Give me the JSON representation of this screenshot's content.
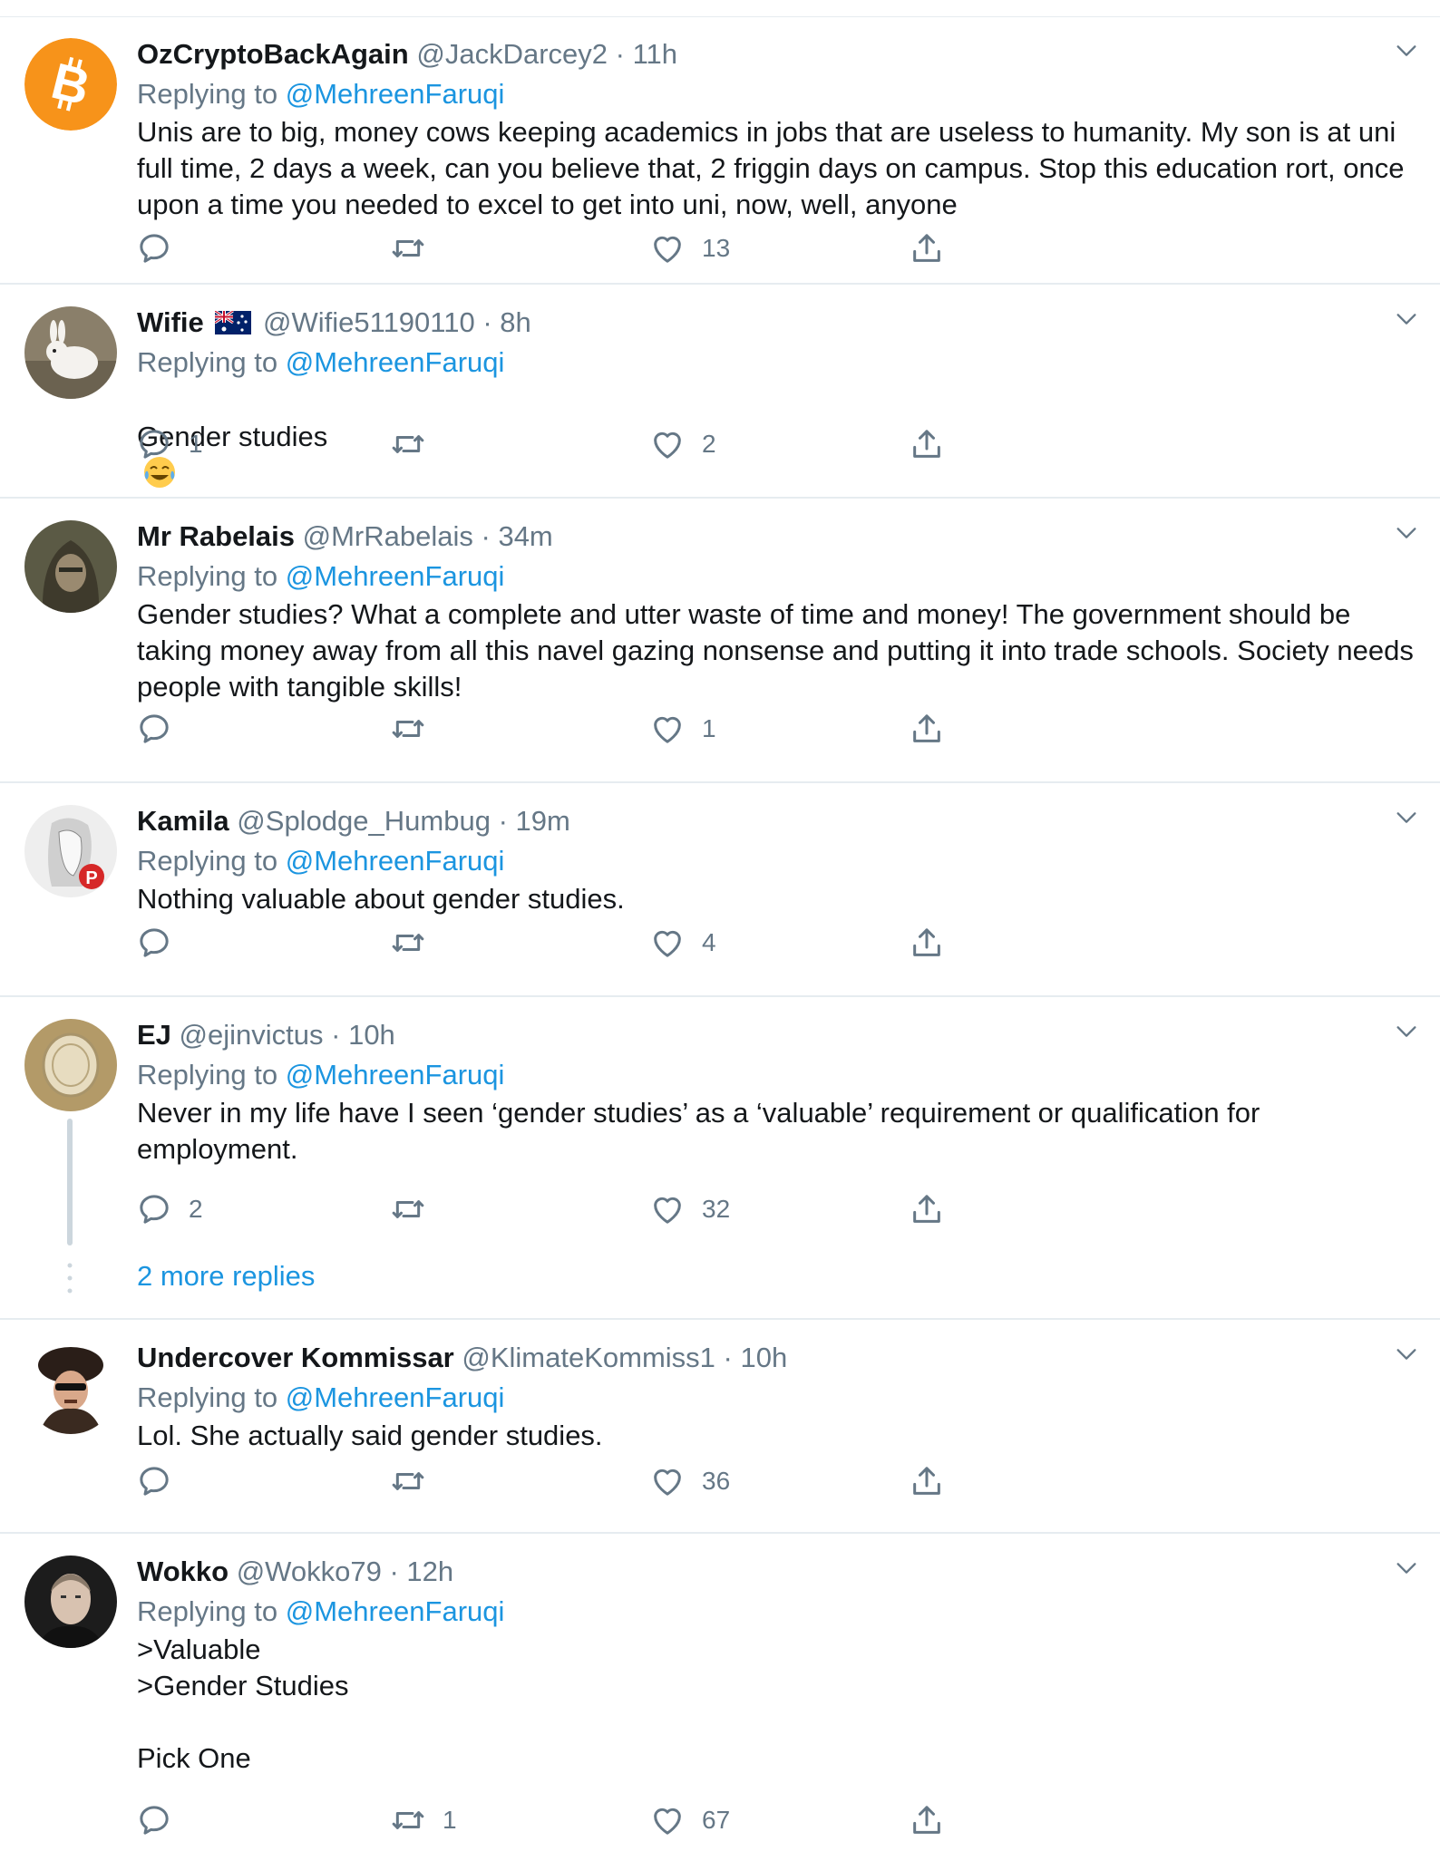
{
  "colors": {
    "link": "#1b95e0",
    "secondary": "#657786",
    "divider": "#e6ecf0",
    "bitcoin": "#f7931a"
  },
  "icons": {
    "reply": "reply-icon",
    "retweet": "retweet-icon",
    "like": "heart-icon",
    "share": "share-icon",
    "more": "chevron-down-icon"
  },
  "tweets": [
    {
      "name": "OzCryptoBackAgain",
      "handle": "@JackDarcey2",
      "time": "· 11h",
      "replying_prefix": "Replying to",
      "replying_to": "@MehreenFaruqi",
      "text": "Unis are to big, money cows keeping academics in jobs that are useless to humanity. My son is at uni full time, 2 days a week, can you believe that, 2 friggin days on campus. Stop this education rort, once upon a time you needed to excel to get into uni, now, well, anyone",
      "replies": "",
      "retweets": "",
      "likes": "13"
    },
    {
      "name": "Wifie",
      "handle": "@Wifie51190110",
      "time": "· 8h",
      "replying_prefix": "Replying to",
      "replying_to": "@MehreenFaruqi",
      "text": "Gender studies",
      "replies": "1",
      "retweets": "",
      "likes": "2"
    },
    {
      "name": "Mr Rabelais",
      "handle": "@MrRabelais",
      "time": "· 34m",
      "replying_prefix": "Replying to",
      "replying_to": "@MehreenFaruqi",
      "text": "Gender studies? What a complete and utter waste of time and money! The government should be taking money away from all this navel gazing nonsense and putting it into trade schools. Society needs people with tangible skills!",
      "replies": "",
      "retweets": "",
      "likes": "1"
    },
    {
      "name": "Kamila",
      "handle": "@Splodge_Humbug",
      "time": "· 19m",
      "replying_prefix": "Replying to",
      "replying_to": "@MehreenFaruqi",
      "text": "Nothing valuable about gender studies.",
      "replies": "",
      "retweets": "",
      "likes": "4"
    },
    {
      "name": "EJ",
      "handle": "@ejinvictus",
      "time": "· 10h",
      "replying_prefix": "Replying to",
      "replying_to": "@MehreenFaruqi",
      "text": "Never in my life have I seen ‘gender studies’ as a ‘valuable’ requirement or qualification for employment.",
      "replies": "2",
      "retweets": "",
      "likes": "32",
      "more_replies": "2 more replies"
    },
    {
      "name": "Undercover Kommissar",
      "handle": "@KlimateKommiss1",
      "time": "· 10h",
      "replying_prefix": "Replying to",
      "replying_to": "@MehreenFaruqi",
      "text": "Lol. She actually said gender studies.",
      "replies": "",
      "retweets": "",
      "likes": "36"
    },
    {
      "name": "Wokko",
      "handle": "@Wokko79",
      "time": "· 12h",
      "replying_prefix": "Replying to",
      "replying_to": "@MehreenFaruqi",
      "text": ">Valuable\n>Gender Studies\n\nPick One",
      "replies": "",
      "retweets": "1",
      "likes": "67"
    }
  ]
}
